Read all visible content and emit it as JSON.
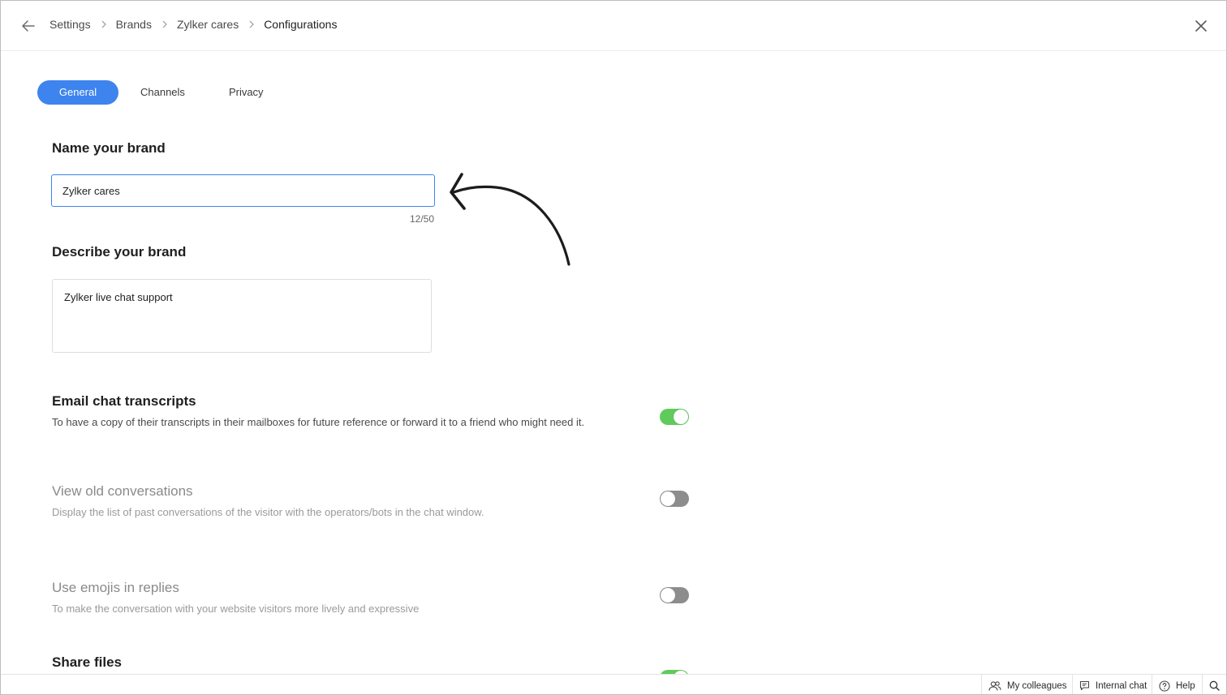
{
  "breadcrumb": [
    "Settings",
    "Brands",
    "Zylker cares",
    "Configurations"
  ],
  "tabs": [
    {
      "label": "General",
      "active": true
    },
    {
      "label": "Channels",
      "active": false
    },
    {
      "label": "Privacy",
      "active": false
    }
  ],
  "brand_name": {
    "heading": "Name your brand",
    "value": "Zylker cares",
    "counter": "12/50"
  },
  "brand_description": {
    "heading": "Describe your brand",
    "value": "Zylker live chat support"
  },
  "settings": [
    {
      "title": "Email chat transcripts",
      "description": "To have a copy of their transcripts in their mailboxes for future reference or forward it to a friend who might need it.",
      "enabled": true
    },
    {
      "title": "View old conversations",
      "description": "Display the list of past conversations of the visitor with the operators/bots in the chat window.",
      "enabled": false
    },
    {
      "title": "Use emojis in replies",
      "description": "To make the conversation with your website visitors more lively and expressive",
      "enabled": false
    },
    {
      "title": "Share files",
      "description": "",
      "enabled": true
    }
  ],
  "bottom_bar": {
    "colleagues": "My colleagues",
    "internal_chat": "Internal chat",
    "help": "Help"
  },
  "colors": {
    "accent": "#3d84ee",
    "toggle_on": "#5fcb5b",
    "toggle_off": "#8d8d8d"
  },
  "icons": [
    "back-arrow-icon",
    "chevron-right-icon",
    "close-icon",
    "colleagues-icon",
    "chat-bubble-icon",
    "help-circle-icon",
    "search-icon"
  ]
}
